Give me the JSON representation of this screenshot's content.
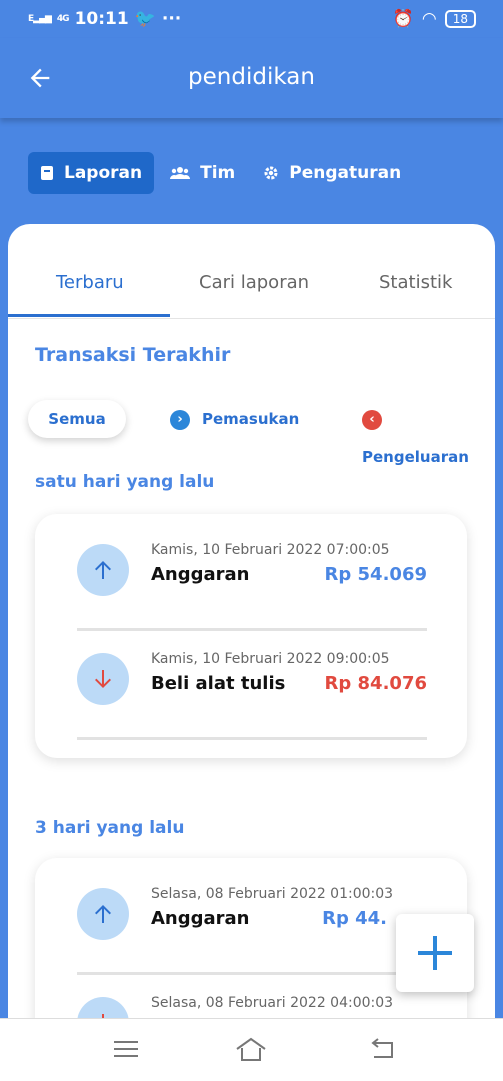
{
  "status_bar": {
    "time": "10:11",
    "network": "4G",
    "battery": "18"
  },
  "appbar": {
    "title": "pendidikan"
  },
  "top_nav": [
    {
      "label": "Laporan",
      "icon": "book-icon"
    },
    {
      "label": "Tim",
      "icon": "users-icon"
    },
    {
      "label": "Pengaturan",
      "icon": "gear-icon"
    }
  ],
  "tabs": [
    "Terbaru",
    "Cari laporan",
    "Statistik"
  ],
  "section_title": "Transaksi Terakhir",
  "filters": {
    "all": "Semua",
    "income": "Pemasukan",
    "expense": "Pengeluaran"
  },
  "groups": [
    {
      "label": "satu hari yang lalu",
      "items": [
        {
          "date": "Kamis, 10 Februari 2022 07:00:05",
          "name": "Anggaran",
          "amount": "Rp 54.069",
          "type": "in"
        },
        {
          "date": "Kamis, 10 Februari 2022 09:00:05",
          "name": "Beli alat tulis",
          "amount": "Rp 84.076",
          "type": "out"
        }
      ]
    },
    {
      "label": "3 hari yang lalu",
      "items": [
        {
          "date": "Selasa, 08 Februari 2022 01:00:03",
          "name": "Anggaran",
          "amount": "Rp 44.",
          "type": "in"
        },
        {
          "date": "Selasa, 08 Februari 2022 04:00:03",
          "name": "",
          "amount": "",
          "type": "out"
        }
      ]
    }
  ],
  "colors": {
    "primary": "#4a86e3",
    "income": "#4a86e3",
    "expense": "#e14a3f"
  }
}
